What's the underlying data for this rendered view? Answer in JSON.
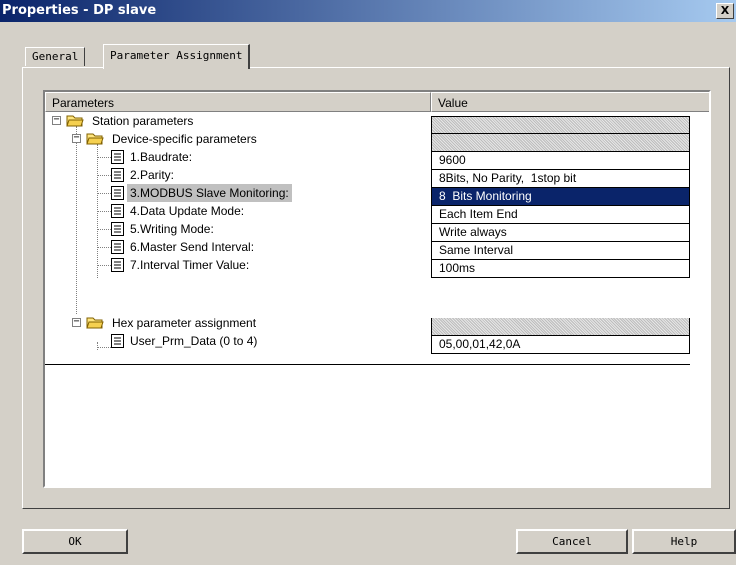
{
  "window": {
    "title": "Properties - DP slave",
    "close_label": "X"
  },
  "tabs": [
    {
      "label": "General",
      "active": false
    },
    {
      "label": "Parameter Assignment",
      "active": true
    }
  ],
  "table": {
    "columns": [
      "Parameters",
      "Value"
    ],
    "rows": [
      {
        "label": "Station parameters",
        "value": "",
        "icon": "folder-open-icon",
        "expander": "minus"
      },
      {
        "label": "Device-specific parameters",
        "value": "",
        "icon": "folder-open-icon",
        "expander": "minus"
      },
      {
        "label": "1.Baudrate:",
        "value": "9600",
        "icon": "document-icon"
      },
      {
        "label": "2.Parity:",
        "value": "8Bits, No Parity,  1stop bit",
        "icon": "document-icon"
      },
      {
        "label": "3.MODBUS Slave Monitoring:",
        "value": "8  Bits Monitoring",
        "icon": "document-icon",
        "selected": true
      },
      {
        "label": "4.Data Update Mode:",
        "value": "Each Item End",
        "icon": "document-icon"
      },
      {
        "label": "5.Writing Mode:",
        "value": "Write always",
        "icon": "document-icon"
      },
      {
        "label": "6.Master Send Interval:",
        "value": "Same Interval",
        "icon": "document-icon"
      },
      {
        "label": "7.Interval Timer Value:",
        "value": "100ms",
        "icon": "document-icon"
      },
      {
        "label": "Hex parameter assignment",
        "value": "",
        "icon": "folder-open-icon",
        "expander": "minus"
      },
      {
        "label": "User_Prm_Data (0 to 4)",
        "value": "05,00,01,42,0A",
        "icon": "document-icon"
      }
    ]
  },
  "buttons": {
    "ok": "OK",
    "cancel": "Cancel",
    "help": "Help"
  },
  "colors": {
    "title_start": "#0a246a",
    "title_end": "#a6caf0",
    "selection": "#0a246a",
    "face": "#d4d0c8"
  }
}
